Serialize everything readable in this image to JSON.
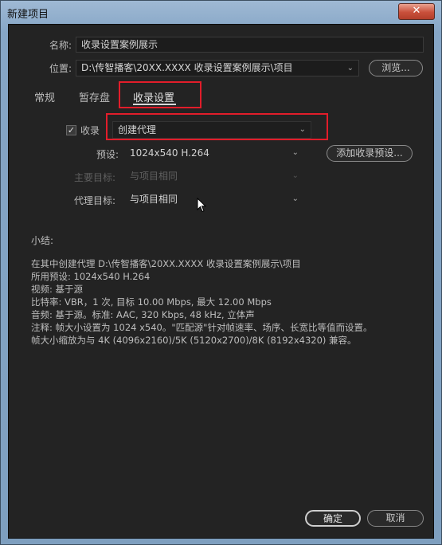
{
  "window": {
    "title": "新建项目",
    "close_glyph": "✕"
  },
  "form": {
    "name_label": "名称:",
    "name_value": "收录设置案例展示",
    "location_label": "位置:",
    "location_value": "D:\\传智播客\\20XX.XXXX 收录设置案例展示\\项目",
    "browse_label": "浏览..."
  },
  "tabs": [
    {
      "label": "常规"
    },
    {
      "label": "暂存盘"
    },
    {
      "label": "收录设置"
    }
  ],
  "ingest": {
    "checkbox_label": "收录",
    "checkbox_checked": true,
    "mode_value": "创建代理",
    "preset_label": "预设:",
    "preset_value": "1024x540 H.264",
    "add_preset_label": "添加收录预设...",
    "primary_label": "主要目标:",
    "primary_value": "与项目相同",
    "proxy_label": "代理目标:",
    "proxy_value": "与项目相同"
  },
  "summary": {
    "title": "小结:",
    "lines": [
      "在其中创建代理 D:\\传智播客\\20XX.XXXX 收录设置案例展示\\项目",
      "所用预设: 1024x540 H.264",
      "视频: 基于源",
      "比特率: VBR，1 次, 目标 10.00 Mbps, 最大 12.00 Mbps",
      "音频: 基于源。标准: AAC, 320 Kbps, 48 kHz, 立体声",
      "注释: 帧大小设置为 1024 x540。\"匹配源\"针对帧速率、场序、长宽比等值而设置。",
      "帧大小缩放为与 4K (4096x2160)/5K (5120x2700)/8K (8192x4320) 兼容。"
    ]
  },
  "buttons": {
    "ok_label": "确定",
    "cancel_label": "取消"
  },
  "colors": {
    "highlight_box": "#e21d2a",
    "panel_bg": "#232323"
  }
}
